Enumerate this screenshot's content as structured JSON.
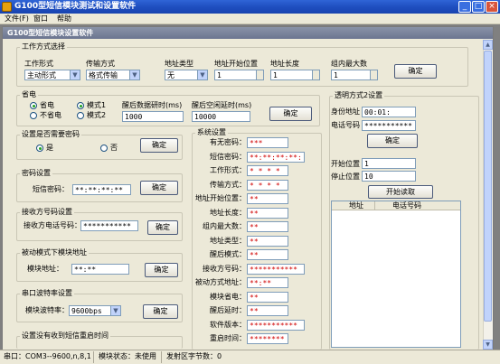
{
  "window": {
    "title": "G100型短信模块测试和设置软件",
    "min": "_",
    "max": "□",
    "close": "×"
  },
  "menu": [
    "文件(F)",
    "窗口",
    "帮助"
  ],
  "child_window": {
    "title": "G100型短信模块设置软件"
  },
  "work_mode": {
    "group": "工作方式选择",
    "work_form_label": "工作形式",
    "work_form_value": "主动形式",
    "transfer_label": "传输方式",
    "transfer_value": "格式传输",
    "addr_type_label": "地址类型",
    "addr_type_value": "无",
    "addr_start_label": "地址开始位置",
    "addr_start_value": "1",
    "addr_len_label": "地址长度",
    "addr_len_value": "1",
    "group_max_label": "组内最大数",
    "group_max_value": "1",
    "confirm": "确定"
  },
  "power_save": {
    "group": "省电",
    "opt_on": "省电",
    "opt_off": "不省电",
    "mode1": "模式1",
    "mode2": "模式2",
    "wake_label": "醒后数据研时(ms)",
    "wake_value": "1000",
    "idle_label": "醒后空闲延时(ms)",
    "idle_value": "10000",
    "confirm": "确定"
  },
  "need_password": {
    "group": "设置是否需要密码",
    "yes": "是",
    "no": "否",
    "confirm": "确定"
  },
  "password_set": {
    "group": "密码设置",
    "label": "短信密码：",
    "value": "**:**:**:**",
    "confirm": "确定"
  },
  "receiver_phone": {
    "group": "接收方号码设置",
    "label": "接收方电话号码：",
    "value": "***********",
    "confirm": "确定"
  },
  "passive_addr": {
    "group": "被动模式下模块地址",
    "label": "模块地址：",
    "value": "**:**",
    "confirm": "确定"
  },
  "baud": {
    "group": "串口波特率设置",
    "label": "模块波特率：",
    "value": "9600bps",
    "confirm": "确定"
  },
  "no_sms_time": {
    "group": "设置没有收到短信重启时间"
  },
  "system": {
    "group": "系统设置",
    "rows": [
      {
        "label": "有无密码：",
        "value": "***"
      },
      {
        "label": "短信密码：",
        "value": "**:**:**:**:"
      },
      {
        "label": "工作形式：",
        "value": "* * * *"
      },
      {
        "label": "传输方式：",
        "value": "* * * *"
      },
      {
        "label": "地址开始位置：",
        "value": "**"
      },
      {
        "label": "地址长度：",
        "value": "**"
      },
      {
        "label": "组内最大数：",
        "value": "**"
      },
      {
        "label": "地址类型：",
        "value": "**"
      },
      {
        "label": "醒后模式：",
        "value": "**"
      },
      {
        "label": "接收方号码：",
        "value": "***********"
      },
      {
        "label": "被动方式地址：",
        "value": "**:**"
      },
      {
        "label": "模块省电：",
        "value": "**"
      },
      {
        "label": "醒后延时：",
        "value": "**"
      },
      {
        "label": "软件版本：",
        "value": "***********"
      },
      {
        "label": "重启时间：",
        "value": "********"
      }
    ]
  },
  "transparent": {
    "group": "透明方式2设置",
    "id_label": "身份地址",
    "id_value": "00:01:",
    "phone_label": "电话号码",
    "phone_value": "***********",
    "confirm": "确定",
    "start_label": "开始位置",
    "start_value": "1",
    "stop_label": "停止位置",
    "stop_value": "10",
    "read_button": "开始读取",
    "col_addr": "地址",
    "col_phone": "电话号码"
  },
  "status": {
    "port": "串口：COM3--9600,n,8,1",
    "module": "模块状态：未使用",
    "sent": "发射区字节数：0"
  }
}
